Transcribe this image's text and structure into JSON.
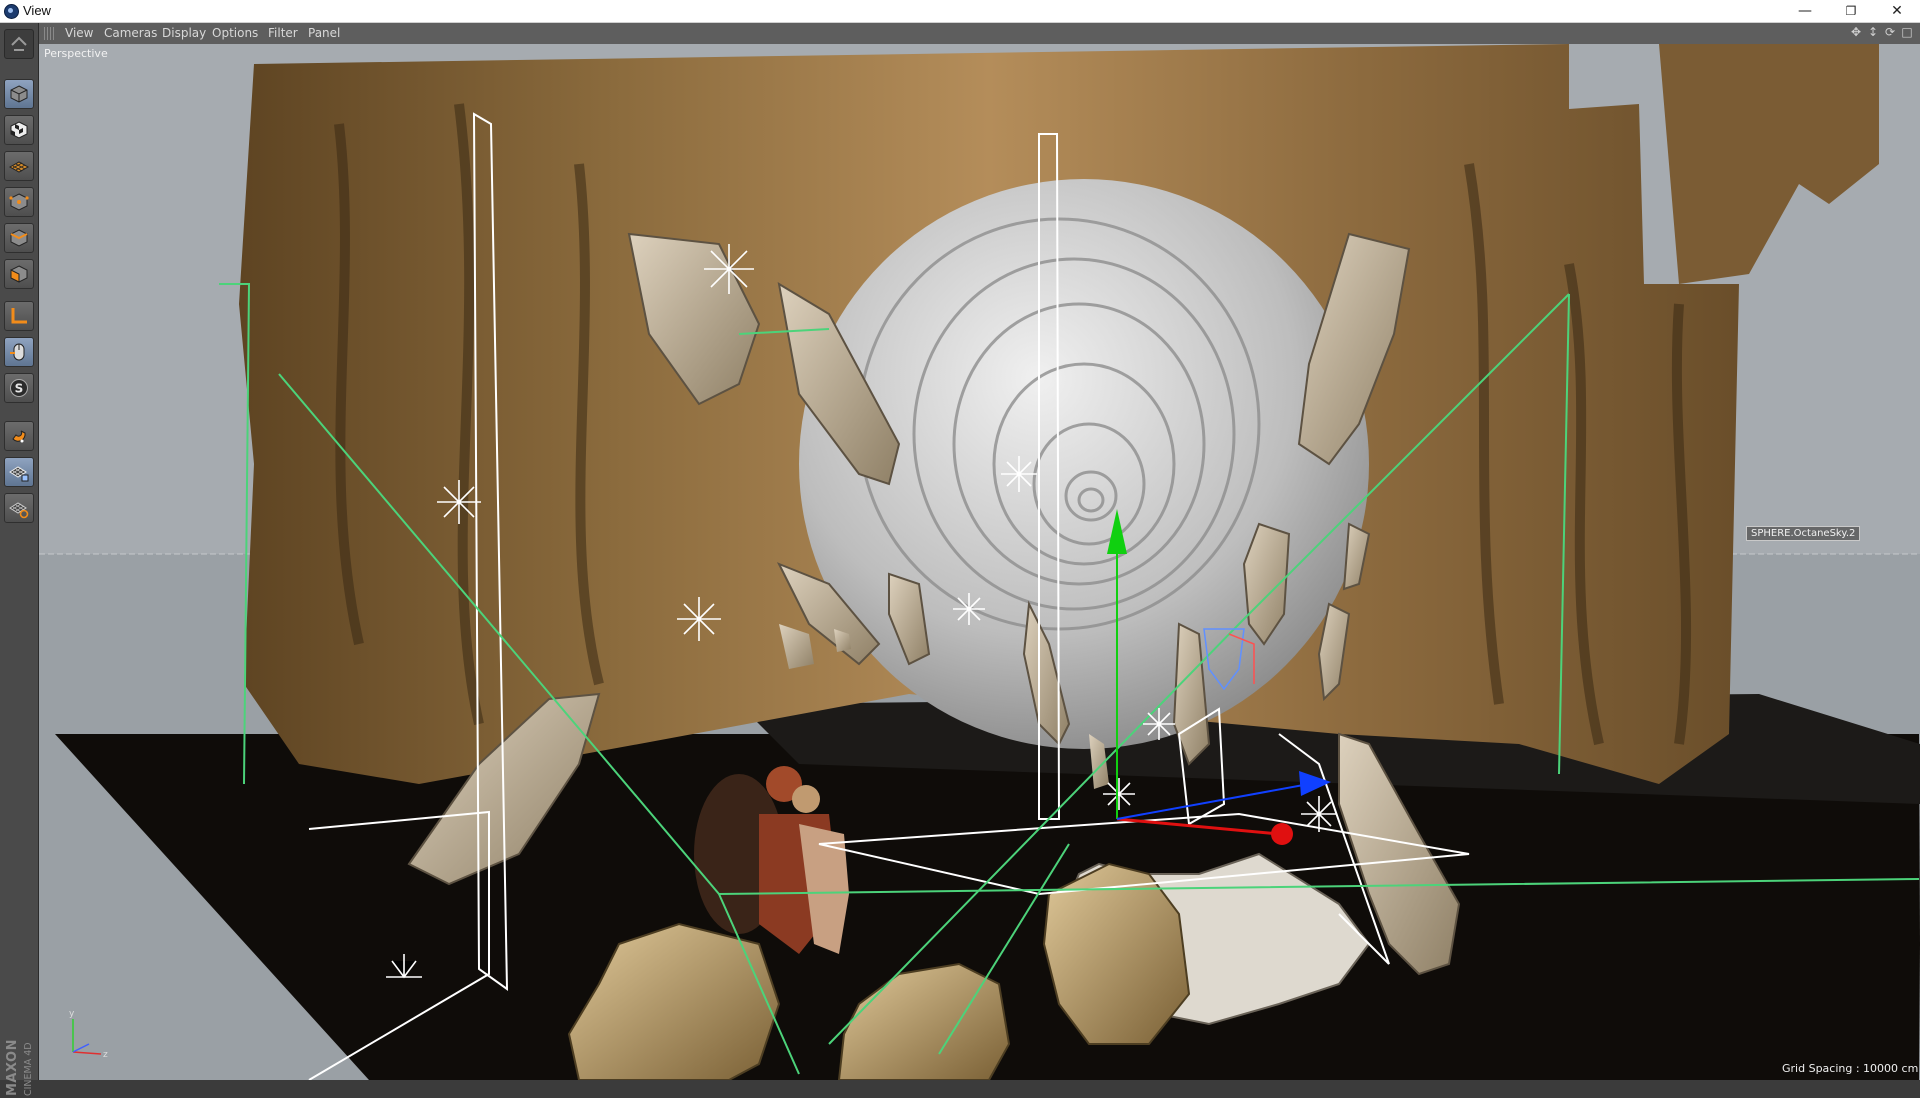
{
  "window": {
    "title": "View"
  },
  "menu": {
    "items": [
      "View",
      "Cameras",
      "Display",
      "Options",
      "Filter",
      "Panel"
    ]
  },
  "viewport": {
    "camera_label": "Perspective",
    "selected_object_label": "SPHERE.OctaneSky.2",
    "grid_spacing": "Grid Spacing : 10000 cm"
  },
  "branding": {
    "logo_text_top": "MAXON",
    "logo_text_bottom": "CINEMA 4D"
  },
  "toolbar": {
    "tools": [
      "model-mode-icon",
      "texture-mode-icon",
      "workplane-mode-icon",
      "points-mode-icon",
      "edges-mode-icon",
      "polygons-mode-icon",
      "axis-mode-icon",
      "tweak-mode-icon",
      "solo-mode-icon",
      "snap-icon",
      "workplane-lock-icon",
      "locked-workplane-icon"
    ]
  },
  "colors": {
    "accent": "#7f95b3",
    "axis_x": "#e01010",
    "axis_y": "#10d010",
    "axis_z": "#1040ff"
  }
}
